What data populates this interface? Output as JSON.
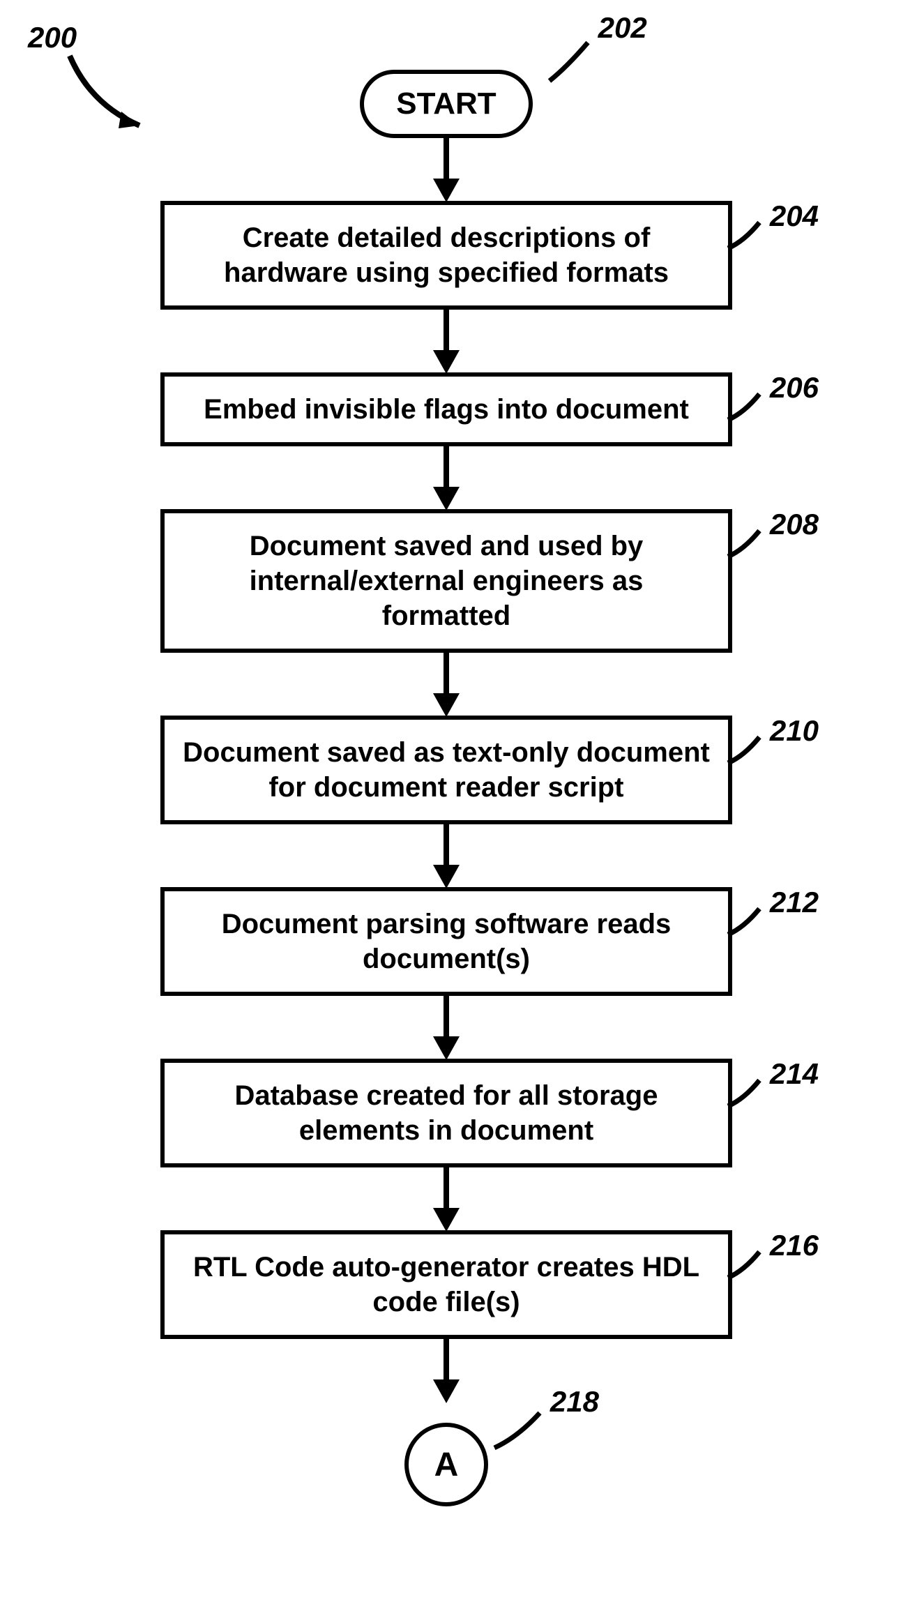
{
  "figure_ref": "200",
  "start": {
    "label": "START",
    "ref": "202"
  },
  "steps": [
    {
      "text": "Create detailed descriptions of hardware using specified formats",
      "ref": "204"
    },
    {
      "text": "Embed invisible flags into document",
      "ref": "206"
    },
    {
      "text": "Document saved and used by internal/external engineers as formatted",
      "ref": "208"
    },
    {
      "text": "Document saved as text-only document for document reader script",
      "ref": "210"
    },
    {
      "text": "Document parsing software reads document(s)",
      "ref": "212"
    },
    {
      "text": "Database created for all storage elements in document",
      "ref": "214"
    },
    {
      "text": "RTL Code auto-generator creates HDL code file(s)",
      "ref": "216"
    }
  ],
  "connector": {
    "label": "A",
    "ref": "218"
  }
}
